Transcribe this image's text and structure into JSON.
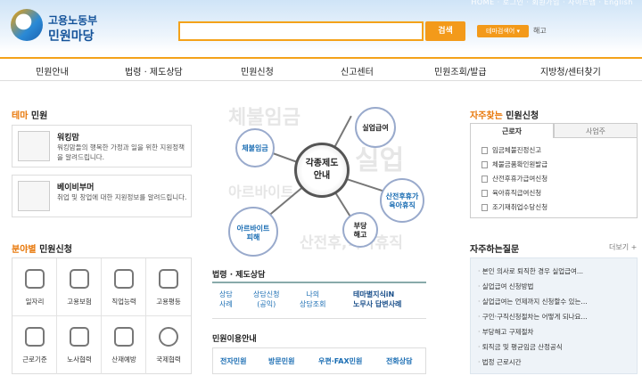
{
  "header": {
    "top_links": "HOME · 로그인 · 회원가입 · 사이트맵 · English",
    "logo_line1": "고용노동부",
    "logo_line2": "민원마당",
    "search_placeholder": "",
    "search_button": "검색",
    "theme_select": "테마검색어 ▾",
    "cancel": "해고"
  },
  "nav": [
    "민원안내",
    "법령 · 제도상담",
    "민원신청",
    "신고센터",
    "민원조회/발급",
    "지방청/센터찾기"
  ],
  "theme": {
    "title_accent": "테마",
    "title_rest": " 민원",
    "cards": [
      {
        "title": "워킹맘",
        "desc": "워킹맘들의 행복한 가정과 일을 위한 지원정책을 알려드립니다."
      },
      {
        "title": "베이비부머",
        "desc": "취업 및 창업에 대한 지원정보를 알려드립니다."
      }
    ]
  },
  "category": {
    "title_accent": "분야별",
    "title_rest": " 민원신청",
    "items": [
      "일자리",
      "고용보험",
      "직업능력",
      "고용평등",
      "근로기준",
      "노사협력",
      "산재예방",
      "국제협력"
    ]
  },
  "diagram": {
    "center": "각종제도\n안내",
    "bubbles": [
      "체불임금",
      "실업급여",
      "산전후휴가\n육아휴직",
      "부당\n해고",
      "아르바이트\n피해"
    ],
    "watermarks": [
      "체불임금",
      "실업",
      "아르바이트",
      "산전후,육아휴직"
    ]
  },
  "laws": {
    "title": "법령 · 제도상담",
    "items": [
      "상담\n사례",
      "상담신청\n(공익)",
      "나의\n상담조회",
      "테마별지식iN\n노무사 답변사례"
    ]
  },
  "civil": {
    "title": "민원이용안내",
    "items": [
      "전자민원",
      "방문민원",
      "우편·FAX민원",
      "전화상담"
    ]
  },
  "popular": {
    "title_accent": "자주찾는",
    "title_rest": " 민원신청",
    "tabs": [
      "근로자",
      "사업주"
    ],
    "items": [
      "임금체불진정신고",
      "체불금품확인원발급",
      "산전후휴가급여신청",
      "육아휴직급여신청",
      "조기재취업수당신청"
    ]
  },
  "faq": {
    "title": "자주하는질문",
    "more": "더보기 +",
    "items": [
      "본인 의사로 퇴직한 경우 실업급여...",
      "실업급여 신청방법",
      "실업급여는 언제까지 신청할수 있는...",
      "구인·구직신청절차는 어떻게 되나요...",
      "부당해고 구제절차",
      "퇴직금 및 평균임금 산정공식",
      "법정 근로시간"
    ]
  },
  "colors": {
    "accent": "#f39a1a",
    "brand": "#14539a",
    "link": "#1a6db3"
  }
}
